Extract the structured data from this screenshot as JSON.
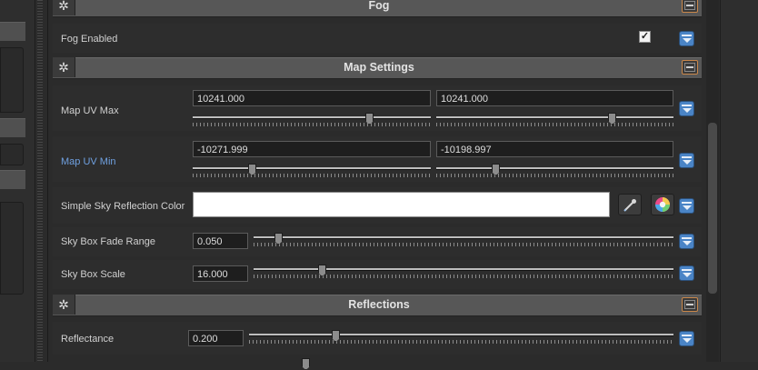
{
  "sections": {
    "fog": {
      "title": "Fog"
    },
    "map_settings": {
      "title": "Map Settings"
    },
    "reflections": {
      "title": "Reflections"
    }
  },
  "fog_enabled": {
    "label": "Fog Enabled",
    "checked": true,
    "check_glyph": "✓"
  },
  "map_uv_max": {
    "label": "Map UV Max",
    "x": {
      "value": "10241.000",
      "slider_fraction": 0.75
    },
    "y": {
      "value": "10241.000",
      "slider_fraction": 0.74
    }
  },
  "map_uv_min": {
    "label": "Map UV Min",
    "x": {
      "value": "-10271.999",
      "slider_fraction": 0.24
    },
    "y": {
      "value": "-10198.997",
      "slider_fraction": 0.24
    }
  },
  "sky_reflection_color": {
    "label": "Simple Sky Reflection Color",
    "color": "#ffffff"
  },
  "sky_box_fade_range": {
    "label": "Sky Box Fade Range",
    "value": "0.050",
    "slider_fraction": 0.05
  },
  "sky_box_scale": {
    "label": "Sky Box Scale",
    "value": "16.000",
    "slider_fraction": 0.16
  },
  "reflectance": {
    "label": "Reflectance",
    "value": "0.200",
    "slider_fraction": 0.2
  },
  "colors": {
    "label_blue": "#6fa0e0",
    "dropdown_blue": "#4a84c6",
    "collapse_border": "#c9874a"
  },
  "icons": {
    "section": "gear-icon",
    "eyedropper": "eyedropper-icon",
    "color_wheel": "color-wheel-icon"
  }
}
